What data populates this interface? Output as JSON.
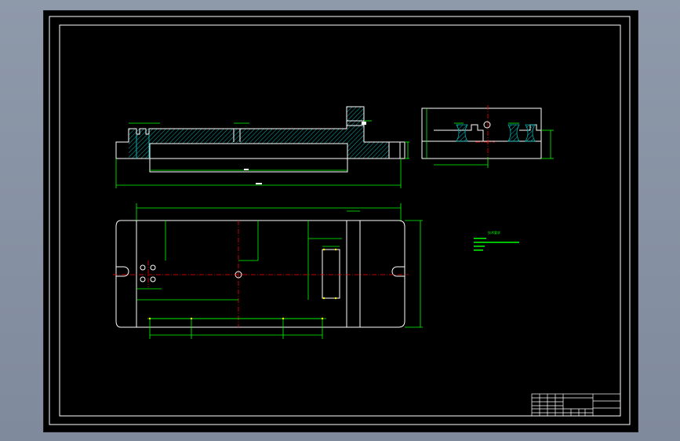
{
  "drawing": {
    "background_color": "#000000",
    "outline_color": "#ffffff",
    "dimension_color": "#00ff00",
    "centerline_color": "#ff0000",
    "hatch_color": "#00b4b4",
    "hole_color": "#ffff00",
    "views": [
      "front-section-view",
      "side-view",
      "top-view"
    ],
    "technical_notes": {
      "title": "技术要求",
      "lines": [
        "",
        "",
        "",
        ""
      ]
    },
    "title_block": {
      "rows": 6,
      "cols": 4
    }
  }
}
